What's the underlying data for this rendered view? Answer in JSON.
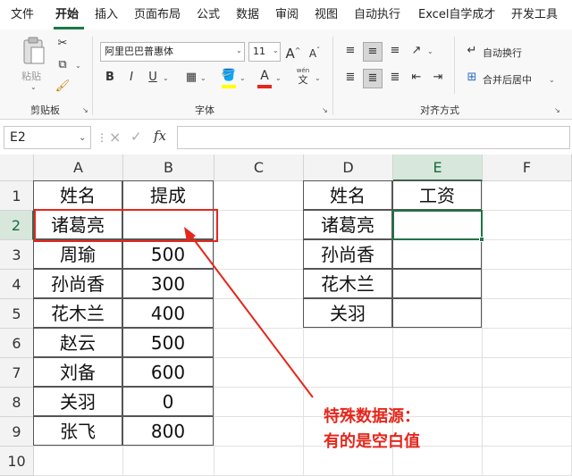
{
  "menu": {
    "tabs": [
      "文件",
      "开始",
      "插入",
      "页面布局",
      "公式",
      "数据",
      "审阅",
      "视图",
      "自动执行",
      "Excel自学成才",
      "开发工具"
    ],
    "active": "开始"
  },
  "ribbon": {
    "clipboard": {
      "paste_label": "粘贴",
      "group_label": "剪贴板"
    },
    "font": {
      "font_name": "阿里巴巴普惠体",
      "font_size": "11",
      "bold": "B",
      "italic": "I",
      "underline": "U",
      "grow": "A",
      "shrink": "A",
      "font_color": "A",
      "wen": "wén",
      "wen_char": "文",
      "group_label": "字体"
    },
    "alignment": {
      "wrap_text": "自动换行",
      "merge_center": "合并后居中",
      "group_label": "对齐方式"
    }
  },
  "formula_bar": {
    "name_box": "E2",
    "fx": "fx",
    "cancel": "×",
    "confirm": "✓",
    "value": ""
  },
  "columns": [
    "A",
    "B",
    "C",
    "D",
    "E",
    "F"
  ],
  "rows": [
    "1",
    "2",
    "3",
    "4",
    "5",
    "6",
    "7",
    "8",
    "9",
    "10"
  ],
  "source_table": {
    "headers": [
      "姓名",
      "提成"
    ],
    "rows": [
      [
        "诸葛亮",
        ""
      ],
      [
        "周瑜",
        "500"
      ],
      [
        "孙尚香",
        "300"
      ],
      [
        "花木兰",
        "400"
      ],
      [
        "赵云",
        "500"
      ],
      [
        "刘备",
        "600"
      ],
      [
        "关羽",
        "0"
      ],
      [
        "张飞",
        "800"
      ]
    ]
  },
  "lookup_table": {
    "headers": [
      "姓名",
      "工资"
    ],
    "rows": [
      [
        "诸葛亮",
        ""
      ],
      [
        "孙尚香",
        ""
      ],
      [
        "花木兰",
        ""
      ],
      [
        "关羽",
        ""
      ]
    ]
  },
  "annotation": {
    "line1": "特殊数据源：",
    "line2": "有的是空白值",
    "color": "#e5261c"
  },
  "colors": {
    "accent": "#217346",
    "selected_header": "#d7e7dc"
  }
}
